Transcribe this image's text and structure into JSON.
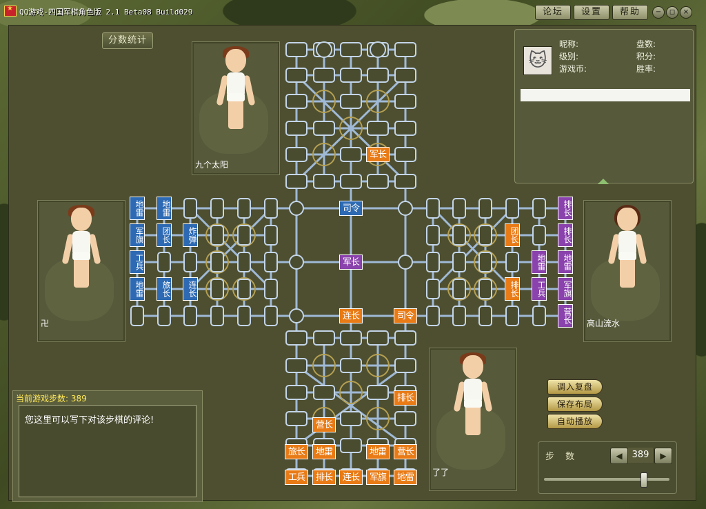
{
  "window": {
    "title": "QQ游戏-四国军棋角色版 2.1 Beta08 Build029",
    "buttons": {
      "forum": "论坛",
      "settings": "设置",
      "help": "帮助"
    },
    "controls": {
      "minimize": "−",
      "restore": "◻",
      "close": "×"
    }
  },
  "score_tab": "分数统计",
  "players": {
    "top": {
      "name": "九个太阳",
      "gender": "male"
    },
    "left": {
      "name": "卍",
      "gender": "male"
    },
    "right": {
      "name": "高山流水",
      "gender": "female"
    },
    "bottom": {
      "name": "了了",
      "gender": "male"
    }
  },
  "info_panel": {
    "nickname_label": "昵称:",
    "level_label": "级别:",
    "coins_label": "游戏币:",
    "games_label": "盘数:",
    "points_label": "积分:",
    "winrate_label": "胜率:"
  },
  "comment": {
    "header": "当前游戏步数: 389",
    "text": "您这里可以写下对该步棋的评论!"
  },
  "replay_buttons": {
    "load": "调入复盘",
    "save": "保存布局",
    "auto": "自动播放"
  },
  "steps": {
    "label": "步 数",
    "value": "389",
    "prev": "◀",
    "next": "▶",
    "slider_fraction": 1.0
  },
  "colors": {
    "orange": "#e97b16",
    "blue": "#2d6ab3",
    "purple": "#8a42ac",
    "board_line": "#9fb9d6"
  },
  "pieces": {
    "top": [
      "军长"
    ],
    "center": [
      "司令",
      "军长",
      "连长",
      "司令"
    ],
    "bottom": [
      "排长",
      "营长",
      "旅长",
      "地雷",
      "地雷",
      "营长",
      "工兵",
      "排长",
      "连长",
      "军旗",
      "地雷"
    ],
    "left": [
      "地雷",
      "地雷",
      "军旗",
      "团长",
      "炸弹",
      "工兵",
      "地雷",
      "旅长",
      "连长"
    ],
    "right": [
      "团长",
      "排长",
      "排长",
      "地雷",
      "地雷",
      "工兵",
      "军旗",
      "排长",
      "营长"
    ]
  }
}
